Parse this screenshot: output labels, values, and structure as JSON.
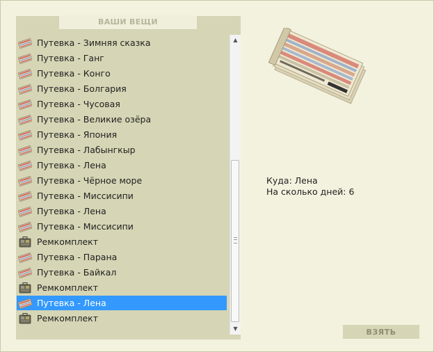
{
  "panel": {
    "title": "ВАШИ ВЕЩИ"
  },
  "items": [
    {
      "label": "Путевка - Зимняя сказка",
      "icon": "voucher-icon"
    },
    {
      "label": "Путевка - Ганг",
      "icon": "voucher-icon"
    },
    {
      "label": "Путевка - Конго",
      "icon": "voucher-icon"
    },
    {
      "label": "Путевка - Болгария",
      "icon": "voucher-icon"
    },
    {
      "label": "Путевка - Чусовая",
      "icon": "voucher-icon"
    },
    {
      "label": "Путевка - Великие озёра",
      "icon": "voucher-icon"
    },
    {
      "label": "Путевка - Япония",
      "icon": "voucher-icon"
    },
    {
      "label": "Путевка - Лабынгкыр",
      "icon": "voucher-icon"
    },
    {
      "label": "Путевка - Лена",
      "icon": "voucher-icon"
    },
    {
      "label": "Путевка - Чёрное море",
      "icon": "voucher-icon"
    },
    {
      "label": "Путевка - Миссисипи",
      "icon": "voucher-icon"
    },
    {
      "label": "Путевка - Лена",
      "icon": "voucher-icon"
    },
    {
      "label": "Путевка - Миссисипи",
      "icon": "voucher-icon"
    },
    {
      "label": "Ремкомплект",
      "icon": "repair-kit-icon"
    },
    {
      "label": "Путевка - Парана",
      "icon": "voucher-icon"
    },
    {
      "label": "Путевка - Байкал",
      "icon": "voucher-icon"
    },
    {
      "label": "Ремкомплект",
      "icon": "repair-kit-icon"
    },
    {
      "label": "Путевка - Лена",
      "icon": "voucher-icon",
      "selected": true
    },
    {
      "label": "Ремкомплект",
      "icon": "repair-kit-icon"
    }
  ],
  "details": {
    "destination": "Куда: Лена",
    "days": "На сколько дней: 6"
  },
  "take_button": {
    "label": "ВЗЯТЬ"
  },
  "colors": {
    "background": "#f3f2df",
    "panel": "#d6d5b5",
    "selection": "#3399ff"
  }
}
